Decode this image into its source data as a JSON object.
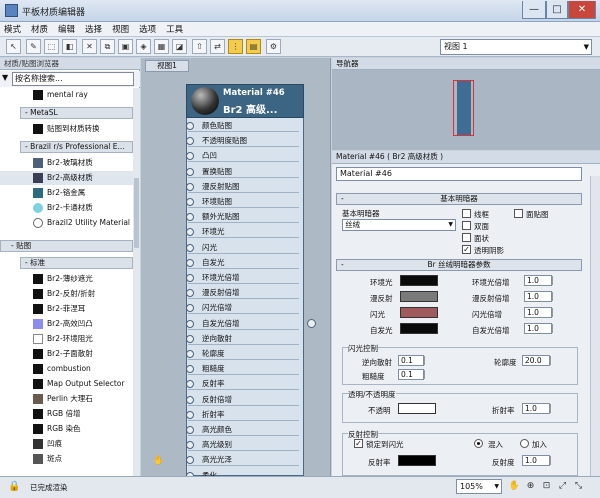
{
  "window": {
    "title": "平板材质编辑器",
    "min_label": "—",
    "max_label": "□",
    "close_label": "✕"
  },
  "menu": [
    "模式",
    "材质",
    "编辑",
    "选择",
    "视图",
    "选项",
    "工具"
  ],
  "toolbar": {
    "view_select": "视图 1"
  },
  "browser": {
    "header": "材质/贴图浏览器",
    "search_placeholder": "按名称搜索...",
    "items_top": [
      {
        "label": "mental ray"
      }
    ],
    "group_metasl": "- MetaSL",
    "metasl_items": [
      "贴图到材质转换"
    ],
    "group_brazil": "- Brazil r/s Professional E...",
    "brazil_items": [
      "Br2-玻璃材质",
      "Br2-高级材质",
      "Br2-铬金属",
      "Br2-卡通材质",
      "Brazil2 Utility Material"
    ],
    "group_maps": "- 贴图",
    "subgroup_std": "- 标准",
    "map_items": [
      "Br2-薄纱遮光",
      "Br2-反射/折射",
      "Br2-菲涅耳",
      "Br2-高效凹凸",
      "Br2-环境阻光",
      "Br2-子面散射",
      "combustion",
      "Map Output Selector",
      "Perlin 大理石",
      "RGB 倍增",
      "RGB 染色",
      "凹痕",
      "斑点"
    ]
  },
  "canvas": {
    "tab": "视图1",
    "node": {
      "title": "Material #46",
      "subtitle": "Br2 高级...",
      "slots": [
        "颜色贴图",
        "不透明度贴图",
        "凸凹",
        "置换贴图",
        "漫反射贴图",
        "环境贴图",
        "额外光贴图",
        "环境光",
        "闪光",
        "自发光",
        "环境光倍增",
        "漫反射倍增",
        "闪光倍增",
        "自发光倍增",
        "逆向散射",
        "轮廓度",
        "粗糙度",
        "反射率",
        "反射倍增",
        "折射率",
        "高光颜色",
        "高光级别",
        "高光光泽",
        "柔化"
      ]
    }
  },
  "navigator": {
    "header": "导航器"
  },
  "properties": {
    "header": "Material #46 ( Br2 高级材质 )",
    "name": "Material #46",
    "basic": {
      "section": "基本明暗器",
      "shader_label": "基本明暗器",
      "shader_value": "丝绒",
      "checkboxes": [
        {
          "label": "线框",
          "checked": false
        },
        {
          "label": "面贴图",
          "checked": false
        },
        {
          "label": "双面",
          "checked": false
        },
        {
          "label": "面状",
          "checked": false
        },
        {
          "label": "透明阴影",
          "checked": true
        }
      ]
    },
    "params": {
      "section": "Br 丝绒明暗器参数",
      "color_rows": [
        {
          "label": "环境光",
          "color": "#0a0a0a",
          "mult_label": "环境光倍增",
          "mult": "1.0"
        },
        {
          "label": "漫反射",
          "color": "#7a7a7a",
          "mult_label": "漫反射倍增",
          "mult": "1.0"
        },
        {
          "label": "闪光",
          "color": "#a05a5e",
          "mult_label": "闪光倍增",
          "mult": "1.0"
        },
        {
          "label": "自发光",
          "color": "#0a0a0a",
          "mult_label": "自发光倍增",
          "mult": "1.0"
        }
      ],
      "flash": {
        "title": "闪光控制",
        "backscatter_label": "逆向散射",
        "backscatter": "0.1",
        "roughness_label": "粗糙度",
        "roughness": "0.1",
        "contour_label": "轮廓度",
        "contour": "20.0"
      },
      "transparency": {
        "title": "透明/不透明度",
        "opacity_label": "不透明",
        "opacity_color": "#ffffff",
        "ior_label": "折射率",
        "ior": "1.0"
      },
      "reflection": {
        "title": "反射控制",
        "lock_label": "锁定到闪光",
        "lock_checked": true,
        "blend_label": "混入",
        "add_label": "加入",
        "mode": "blend",
        "reflect_label": "反射率",
        "reflect_color": "#000000",
        "refl_label": "反射度",
        "refl": "1.0"
      }
    }
  },
  "status": {
    "text": "已完成渲染",
    "zoom": "105%"
  }
}
